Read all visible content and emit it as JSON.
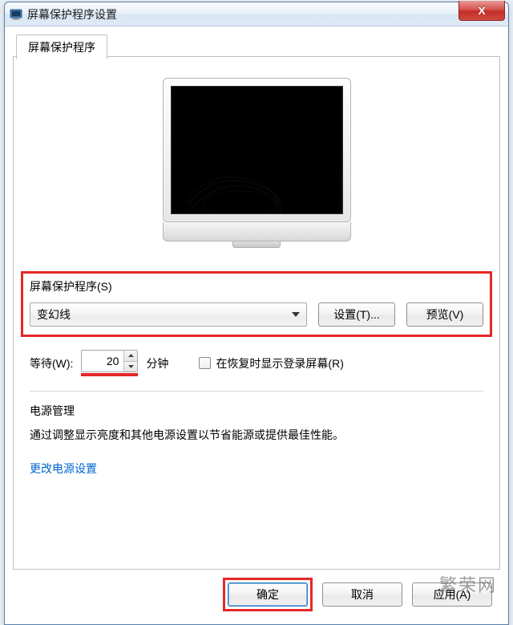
{
  "window": {
    "title": "屏幕保护程序设置",
    "close_symbol": "X"
  },
  "tab": {
    "label": "屏幕保护程序"
  },
  "screensaver": {
    "group_label": "屏幕保护程序(S)",
    "selected": "变幻线",
    "settings_btn": "设置(T)...",
    "preview_btn": "预览(V)"
  },
  "wait": {
    "label": "等待(W):",
    "value": "20",
    "unit": "分钟",
    "checkbox_label": "在恢复时显示登录屏幕(R)",
    "checkbox_checked": false
  },
  "power": {
    "group_label": "电源管理",
    "description": "通过调整显示亮度和其他电源设置以节省能源或提供最佳性能。",
    "link": "更改电源设置"
  },
  "buttons": {
    "ok": "确定",
    "cancel": "取消",
    "apply": "应用(A)"
  },
  "watermark": "繁荣网"
}
